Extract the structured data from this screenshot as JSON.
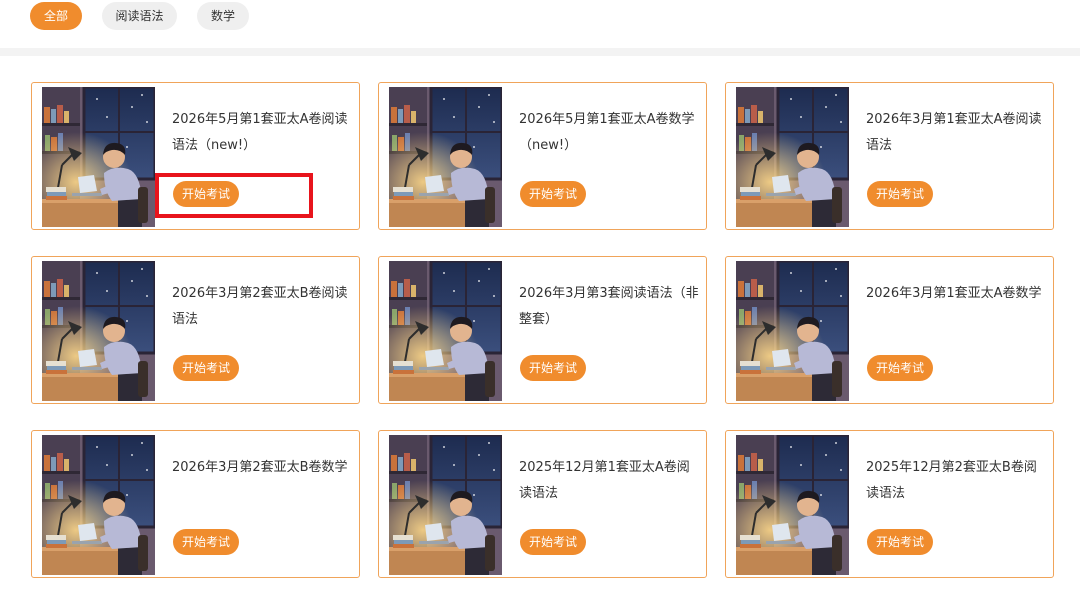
{
  "filters": [
    {
      "label": "全部",
      "active": true
    },
    {
      "label": "阅读语法",
      "active": false
    },
    {
      "label": "数学",
      "active": false
    }
  ],
  "cards": [
    {
      "title": "2026年5月第1套亚太A卷阅读语法（new!）",
      "button": "开始考试"
    },
    {
      "title": "2026年5月第1套亚太A卷数学（new!）",
      "button": "开始考试"
    },
    {
      "title": "2026年3月第1套亚太A卷阅读语法",
      "button": "开始考试"
    },
    {
      "title": "2026年3月第2套亚太B卷阅读语法",
      "button": "开始考试"
    },
    {
      "title": "2026年3月第3套阅读语法（非整套）",
      "button": "开始考试"
    },
    {
      "title": "2026年3月第1套亚太A卷数学",
      "button": "开始考试"
    },
    {
      "title": "2026年3月第2套亚太B卷数学",
      "button": "开始考试"
    },
    {
      "title": "2025年12月第1套亚太A卷阅读语法",
      "button": "开始考试"
    },
    {
      "title": "2025年12月第2套亚太B卷阅读语法",
      "button": "开始考试"
    }
  ],
  "colors": {
    "accent": "#f08c2d",
    "card_border": "#f0a45a",
    "highlight": "#e8141c"
  }
}
